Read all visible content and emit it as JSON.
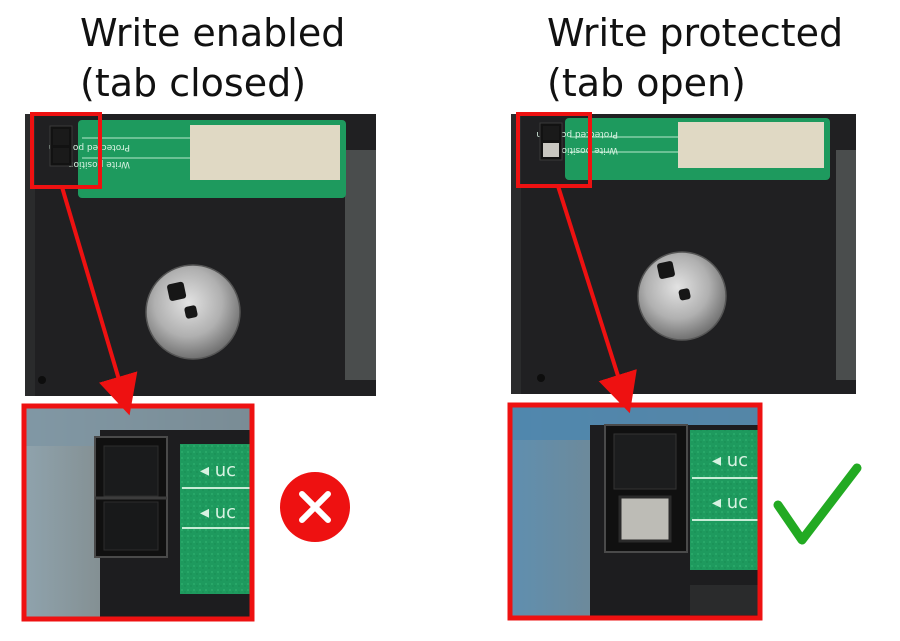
{
  "panels": {
    "left": {
      "title_line1": "Write enabled",
      "title_line2": "(tab closed)",
      "label_line1": "Protected position",
      "label_line2": "Write position",
      "zoom_text_top": "◂ uc",
      "zoom_text_bottom": "◂ uc",
      "status_icon": "cross-icon"
    },
    "right": {
      "title_line1": "Write protected",
      "title_line2": "(tab open)",
      "label_line1": "Protected position",
      "label_line2": "Write position",
      "zoom_text_top": "◂ uc",
      "zoom_text_bottom": "◂ uc",
      "status_icon": "check-icon"
    }
  },
  "colors": {
    "highlight": "#ee1111",
    "cross": "#ee1111",
    "check": "#22aa22",
    "disk": "#1d1d1f",
    "label": "#1e9a5e"
  }
}
